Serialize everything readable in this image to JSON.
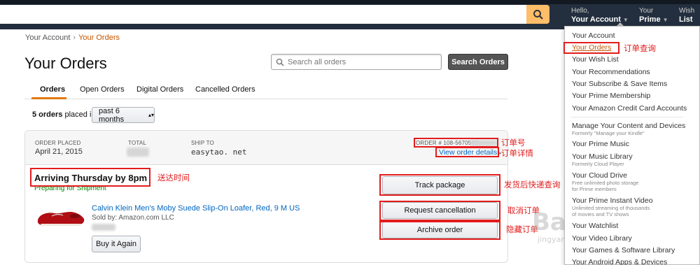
{
  "header": {
    "greeting": "Hello,",
    "your_account": "Your Account",
    "prime_small": "Your",
    "prime_big": "Prime",
    "wish_small": "Wish",
    "wish_big": "List"
  },
  "breadcrumb": {
    "root": "Your Account",
    "separator": "›",
    "current": "Your Orders"
  },
  "page_title": "Your Orders",
  "search": {
    "placeholder": "Search all orders",
    "button": "Search Orders"
  },
  "tabs": [
    "Orders",
    "Open Orders",
    "Digital Orders",
    "Cancelled Orders"
  ],
  "orders_summary": {
    "count": "5 orders",
    "suffix": "placed in",
    "period": "past 6 months"
  },
  "order": {
    "placed_label": "ORDER PLACED",
    "placed_value": "April 21, 2015",
    "total_label": "TOTAL",
    "ship_to_label": "SHIP TO",
    "ship_to_value": "easytao. net",
    "order_number": "ORDER # 108-5670562",
    "view_details": "View order details",
    "arriving": "Arriving Thursday by 8pm",
    "status": "Preparing for Shipment",
    "product_title": "Calvin Klein Men's Moby Suede Slip-On Loafer, Red, 9 M US",
    "sold_by": "Sold by: Amazon.com LLC",
    "buy_again": "Buy it Again",
    "track": "Track package",
    "cancel": "Request cancellation",
    "archive": "Archive order"
  },
  "annotations": {
    "order_number": "订单号",
    "order_details": "订单详情",
    "arrival": "送达时间",
    "track": "发货后快递查询",
    "cancel": "取消订单",
    "archive": "隐藏订单",
    "your_orders": "订单查询"
  },
  "dropdown": {
    "items": [
      "Your Account",
      "Your Orders",
      "Your Wish List",
      "Your Recommendations",
      "Your Subscribe & Save Items",
      "Your Prime Membership",
      "Your Amazon Credit Card Accounts",
      "Manage Your Content and Devices",
      "Your Prime Music",
      "Your Music Library",
      "Your Cloud Drive",
      "Your Prime Instant Video",
      "Your Watchlist",
      "Your Video Library",
      "Your Games & Software Library",
      "Your Android Apps & Devices"
    ],
    "subs": {
      "content": "Formerly \"Manage your Kindle\"",
      "music": "Formerly Cloud Player",
      "drive": "Free unlimited photo storage",
      "drive2": "for Prime members",
      "video": "Unlimited streaming of thousands",
      "video2": "of movies and TV shows"
    }
  },
  "watermark": {
    "main": "Baidu经验",
    "sub": "jingyan.baidu.com"
  },
  "colors": {
    "header_bg": "#232f3e",
    "search_button": "#febd69",
    "link": "#0066c0",
    "orange": "#c45500",
    "annotation": "#e31c1c",
    "green": "#008a00"
  }
}
